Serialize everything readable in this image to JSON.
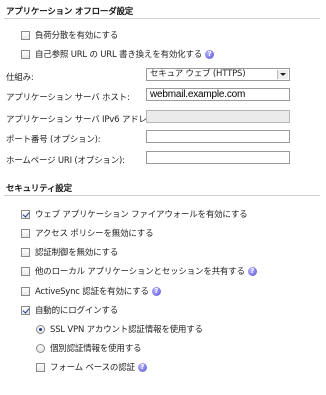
{
  "app_section": {
    "title": "アプリケーション オフローダ設定",
    "options": [
      {
        "label": "負荷分散を有効にする",
        "checked": false,
        "help": false
      },
      {
        "label": "自己参照 URL の URL 書き換えを有効化する",
        "checked": false,
        "help": true
      }
    ],
    "scheme": {
      "label": "仕組み:",
      "value": "セキュア ウェブ (HTTPS)"
    },
    "host": {
      "label": "アプリケーション サーバ ホスト:",
      "value": "webmail.example.com"
    },
    "ipv6": {
      "label": "アプリケーション サーバ IPv6 アドレス:",
      "value": ""
    },
    "port": {
      "label": "ポート番号 (オプション):",
      "value": ""
    },
    "homepage": {
      "label": "ホームページ URI (オプション):",
      "value": ""
    }
  },
  "security_section": {
    "title": "セキュリティ設定",
    "options": [
      {
        "label": "ウェブ アプリケーション ファイアウォールを有効にする",
        "checked": true
      },
      {
        "label": "アクセス ポリシーを無効にする",
        "checked": false
      },
      {
        "label": "認証制御を無効にする",
        "checked": false
      },
      {
        "label": "他のローカル アプリケーションとセッションを共有する",
        "checked": false,
        "help": true
      },
      {
        "label": "ActiveSync 認証を有効にする",
        "checked": false,
        "help": true
      },
      {
        "label": "自動的にログインする",
        "checked": true
      }
    ],
    "auto_login_sub": {
      "sslvpn": "SSL VPN アカウント認証情報を使用する",
      "custom": "個別認証情報を使用する",
      "form": "フォーム ベースの認証"
    }
  },
  "icons": {
    "help": "help-icon",
    "dropdown": "chevron-down-icon"
  }
}
